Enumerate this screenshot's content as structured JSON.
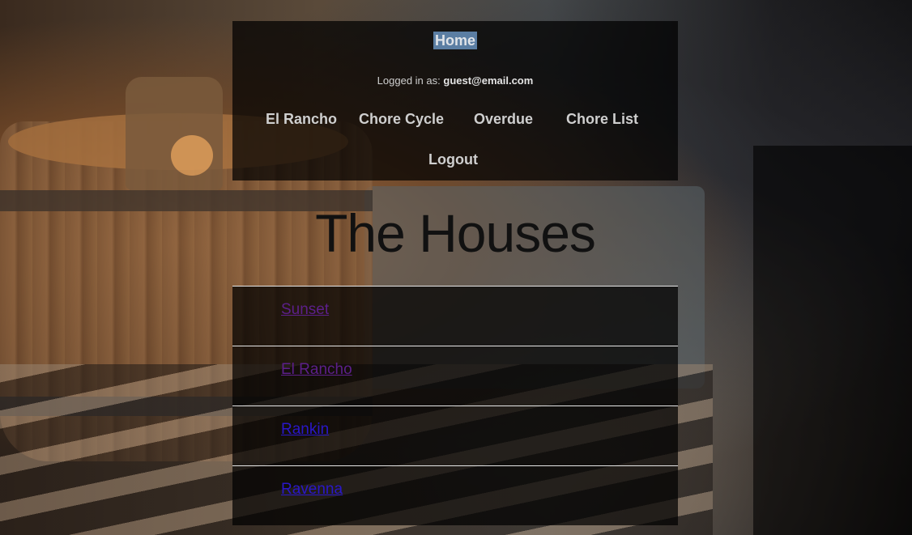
{
  "nav": {
    "home_label": "Home",
    "logged_in_prefix": "Logged in as:",
    "user_email": "guest@email.com",
    "items": [
      {
        "label": "El Rancho"
      },
      {
        "label": "Chore Cycle"
      },
      {
        "label": "Overdue"
      },
      {
        "label": "Chore List"
      },
      {
        "label": "Logout"
      }
    ]
  },
  "main": {
    "title": "The Houses",
    "houses": [
      {
        "name": "Sunset",
        "color": "#5c1f8a"
      },
      {
        "name": "El Rancho",
        "color": "#5c1f8a"
      },
      {
        "name": "Rankin",
        "color": "#2a17c9"
      },
      {
        "name": "Ravenna",
        "color": "#2a17c9"
      }
    ]
  },
  "colors": {
    "home_highlight": "#5b7ea3",
    "panel_bg": "rgba(0,0,0,0.72)"
  }
}
